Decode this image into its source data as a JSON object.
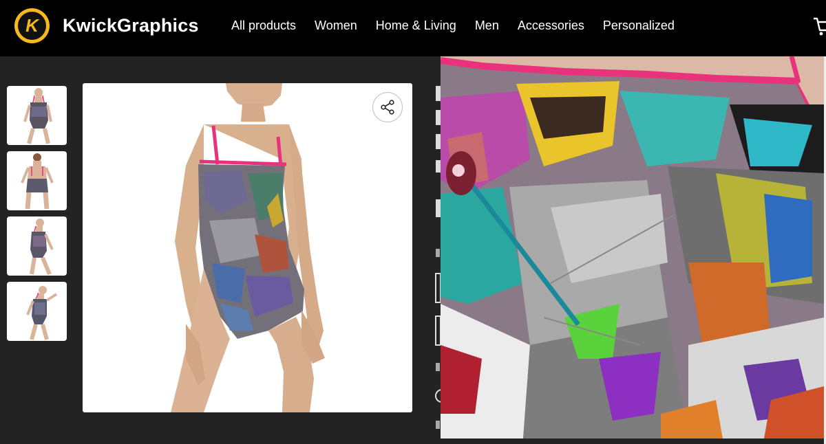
{
  "brand": {
    "name": "KwickGraphics",
    "logo_letter": "K"
  },
  "nav": {
    "items": [
      "All products",
      "Women",
      "Home & Living",
      "Men",
      "Accessories",
      "Personalized"
    ]
  },
  "icons": {
    "cart": "shopping-cart-icon",
    "share": "share-icon"
  },
  "colors": {
    "header_bg": "#000000",
    "page_bg": "#232323",
    "logo_accent": "#f5b91d",
    "swimsuit_strap": "#e8327c"
  },
  "gallery": {
    "thumbnail_count": 4,
    "selected_index": 0
  }
}
